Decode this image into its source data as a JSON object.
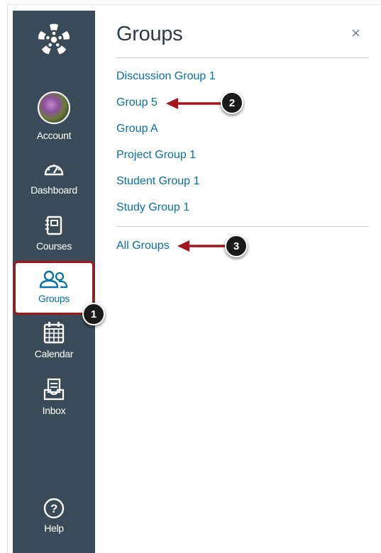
{
  "sidebar": {
    "logo_icon": "canvas-logo-icon",
    "items": [
      {
        "label": "Account",
        "icon": "avatar"
      },
      {
        "label": "Dashboard",
        "icon": "dashboard-icon"
      },
      {
        "label": "Courses",
        "icon": "courses-icon"
      },
      {
        "label": "Groups",
        "icon": "groups-icon"
      },
      {
        "label": "Calendar",
        "icon": "calendar-icon"
      },
      {
        "label": "Inbox",
        "icon": "inbox-icon"
      },
      {
        "label": "Help",
        "icon": "help-icon"
      }
    ]
  },
  "tray": {
    "title": "Groups",
    "close_label": "×",
    "groups": [
      "Discussion Group 1",
      "Group 5",
      "Group A",
      "Project Group 1",
      "Student Group 1",
      "Study Group 1"
    ],
    "all_groups_label": "All Groups"
  },
  "annotations": {
    "badges": [
      "1",
      "2",
      "3"
    ]
  },
  "colors": {
    "sidebar_bg": "#394b58",
    "link": "#0770a3",
    "highlight": "#a4161a"
  }
}
